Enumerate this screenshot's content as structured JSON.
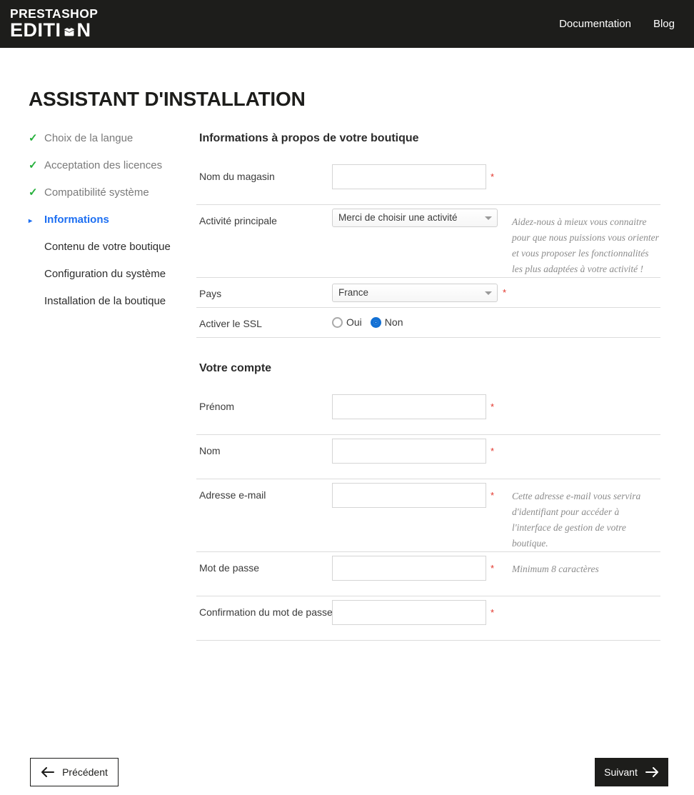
{
  "header": {
    "logo_line1": "PRESTASHOP",
    "logo_line2_pre": "EDITI",
    "logo_line2_post": "N",
    "logo_icon": "open-box-icon",
    "nav": [
      {
        "label": "Documentation"
      },
      {
        "label": "Blog"
      }
    ],
    "background": "#1d1d1b"
  },
  "page": {
    "title": "ASSISTANT D'INSTALLATION"
  },
  "sidebar": {
    "steps": [
      {
        "label": "Choix de la langue",
        "state": "done",
        "marker": "✓"
      },
      {
        "label": "Acceptation des licences",
        "state": "done",
        "marker": "✓"
      },
      {
        "label": "Compatibilité système",
        "state": "done",
        "marker": "✓"
      },
      {
        "label": "Informations",
        "state": "current",
        "marker": "▸"
      },
      {
        "label": "Contenu de votre boutique",
        "state": "todo",
        "marker": ""
      },
      {
        "label": "Configuration du système",
        "state": "todo",
        "marker": ""
      },
      {
        "label": "Installation de la boutique",
        "state": "todo",
        "marker": ""
      }
    ],
    "done_color": "#25b03b",
    "current_color": "#1d6ff2"
  },
  "form": {
    "shop_section_title": "Informations à propos de votre boutique",
    "account_section_title": "Votre compte",
    "required_mark": "*",
    "required_color": "#e2342a",
    "shop_name": {
      "label": "Nom du magasin",
      "value": "",
      "placeholder": ""
    },
    "activity": {
      "label": "Activité principale",
      "selected": "Merci de choisir une activité",
      "hint": "Aidez-nous à mieux vous connaitre pour que nous puissions vous orienter et vous proposer les fonctionnalités les plus adaptées à votre activité !"
    },
    "country": {
      "label": "Pays",
      "selected": "France"
    },
    "ssl": {
      "label": "Activer le SSL",
      "options": [
        {
          "label": "Oui",
          "checked": false
        },
        {
          "label": "Non",
          "checked": true
        }
      ],
      "checked_color": "#1270d4"
    },
    "first_name": {
      "label": "Prénom",
      "value": "",
      "placeholder": ""
    },
    "last_name": {
      "label": "Nom",
      "value": "",
      "placeholder": ""
    },
    "email": {
      "label": "Adresse e-mail",
      "value": "",
      "placeholder": "",
      "hint": "Cette adresse e-mail vous servira d'identifiant pour accéder à l'interface de gestion de votre boutique."
    },
    "password": {
      "label": "Mot de passe",
      "value": "",
      "placeholder": "",
      "hint": "Minimum 8 caractères"
    },
    "password_confirm": {
      "label": "Confirmation du mot de passe",
      "value": "",
      "placeholder": ""
    }
  },
  "footer": {
    "prev_label": "Précédent",
    "next_label": "Suivant",
    "prev_icon": "arrow-left-icon",
    "next_icon": "arrow-right-icon"
  }
}
